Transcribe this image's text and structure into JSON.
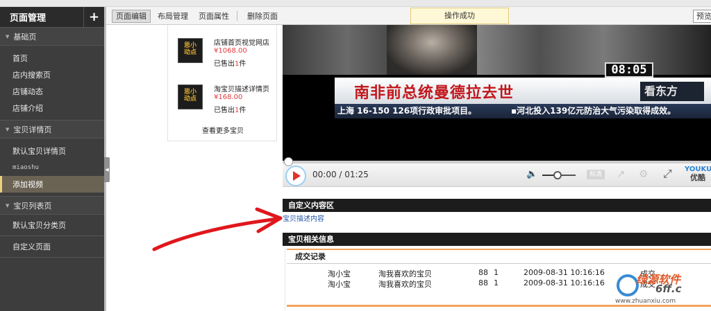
{
  "sidebar": {
    "title": "页面管理",
    "add_label": "+",
    "groups": [
      {
        "label": "基础页",
        "items": [
          "首页",
          "店内搜索页",
          "店铺动态",
          "店铺介绍"
        ]
      },
      {
        "label": "宝贝详情页",
        "items": [
          "默认宝贝详情页",
          "miaoshu",
          "添加视频"
        ]
      },
      {
        "label": "宝贝列表页",
        "items": [
          "默认宝贝分类页"
        ]
      }
    ],
    "custom_page": "自定义页面",
    "active_item": "添加视频"
  },
  "toolbar": {
    "tabs": [
      "页面编辑",
      "布局管理",
      "页面属性",
      "删除页面"
    ],
    "selected_tab": "页面编辑",
    "toast": "操作成功",
    "preview_label": "预览"
  },
  "products": {
    "items": [
      {
        "thumb_text": "思小\n动点",
        "name": "店铺首页视觉网店",
        "price": "¥1068.00",
        "sold_prefix": "已售出",
        "sold_count": "1",
        "sold_suffix": "件"
      },
      {
        "thumb_text": "思小\n动点",
        "name": "淘宝贝描述详情页",
        "price": "¥168.00",
        "sold_prefix": "已售出",
        "sold_count": "1",
        "sold_suffix": "件"
      }
    ],
    "more_label": "查看更多宝贝"
  },
  "video": {
    "headline": "南非前总统曼德拉去世",
    "clock": "08:05",
    "channel_logo": "看东方",
    "ticker_left": "上海 16-150  126项行政审批项目。",
    "ticker_right": "▪河北投入139亿元防治大气污染取得成效。",
    "time": "00:00 / 01:25",
    "progress": 0,
    "volume_fraction": 0.45,
    "hd_label": "标清",
    "brand_en": "YOUKU",
    "brand_zh": "优酷"
  },
  "custom_area": {
    "header": "自定义内容区",
    "link": "宝贝描述内容"
  },
  "related": {
    "header": "宝贝相关信息",
    "trade_title": "成交记录",
    "rows": [
      {
        "buyer": "淘小宝",
        "item": "淘我喜欢的宝贝",
        "price": "88",
        "qty": "1",
        "time": "2009-08-31 10:16:16",
        "status": "成交"
      },
      {
        "buyer": "淘小宝",
        "item": "淘我喜欢的宝贝",
        "price": "88",
        "qty": "1",
        "time": "2009-08-31 10:16:16",
        "status": "成交"
      }
    ]
  },
  "watermark": {
    "top": "绿源软件",
    "mid": "6ff.c",
    "url": "www.zhuanxiu.com"
  },
  "annotation": {
    "color": "#e0171c"
  }
}
